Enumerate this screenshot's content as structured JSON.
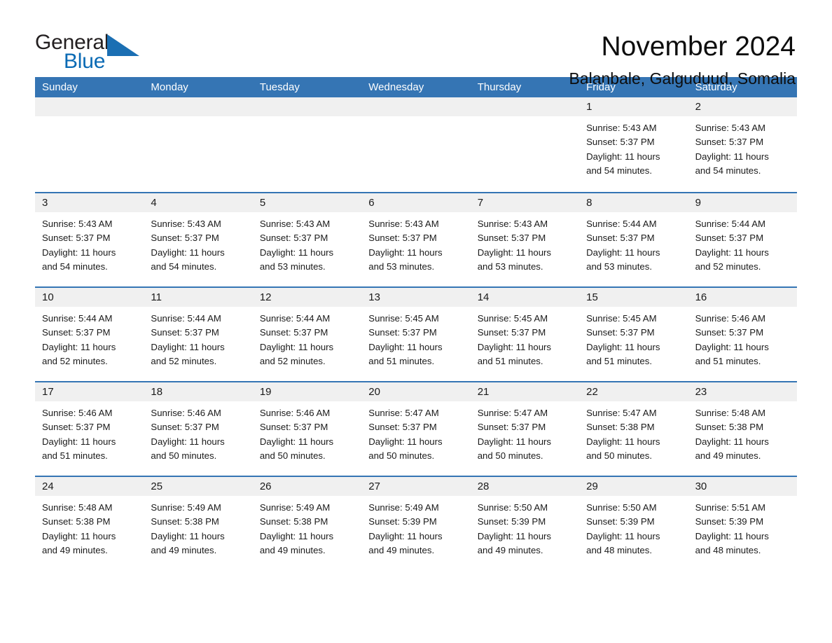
{
  "logo": {
    "text_primary": "General",
    "text_secondary": "Blue",
    "triangle_color": "#1b6fb3",
    "accent_color": "#0a6ab4"
  },
  "header": {
    "title": "November 2024",
    "subtitle": "Balanbale, Galguduud, Somalia"
  },
  "theme": {
    "header_blue": "#3575b4",
    "date_band_gray": "#f0f0f0",
    "text_dark": "#1a1a1a"
  },
  "calendar": {
    "weekdays": [
      "Sunday",
      "Monday",
      "Tuesday",
      "Wednesday",
      "Thursday",
      "Friday",
      "Saturday"
    ],
    "weeks": [
      [
        {
          "day": "",
          "lines": []
        },
        {
          "day": "",
          "lines": []
        },
        {
          "day": "",
          "lines": []
        },
        {
          "day": "",
          "lines": []
        },
        {
          "day": "",
          "lines": []
        },
        {
          "day": "1",
          "lines": [
            "Sunrise: 5:43 AM",
            "Sunset: 5:37 PM",
            "Daylight: 11 hours",
            "and 54 minutes."
          ]
        },
        {
          "day": "2",
          "lines": [
            "Sunrise: 5:43 AM",
            "Sunset: 5:37 PM",
            "Daylight: 11 hours",
            "and 54 minutes."
          ]
        }
      ],
      [
        {
          "day": "3",
          "lines": [
            "Sunrise: 5:43 AM",
            "Sunset: 5:37 PM",
            "Daylight: 11 hours",
            "and 54 minutes."
          ]
        },
        {
          "day": "4",
          "lines": [
            "Sunrise: 5:43 AM",
            "Sunset: 5:37 PM",
            "Daylight: 11 hours",
            "and 54 minutes."
          ]
        },
        {
          "day": "5",
          "lines": [
            "Sunrise: 5:43 AM",
            "Sunset: 5:37 PM",
            "Daylight: 11 hours",
            "and 53 minutes."
          ]
        },
        {
          "day": "6",
          "lines": [
            "Sunrise: 5:43 AM",
            "Sunset: 5:37 PM",
            "Daylight: 11 hours",
            "and 53 minutes."
          ]
        },
        {
          "day": "7",
          "lines": [
            "Sunrise: 5:43 AM",
            "Sunset: 5:37 PM",
            "Daylight: 11 hours",
            "and 53 minutes."
          ]
        },
        {
          "day": "8",
          "lines": [
            "Sunrise: 5:44 AM",
            "Sunset: 5:37 PM",
            "Daylight: 11 hours",
            "and 53 minutes."
          ]
        },
        {
          "day": "9",
          "lines": [
            "Sunrise: 5:44 AM",
            "Sunset: 5:37 PM",
            "Daylight: 11 hours",
            "and 52 minutes."
          ]
        }
      ],
      [
        {
          "day": "10",
          "lines": [
            "Sunrise: 5:44 AM",
            "Sunset: 5:37 PM",
            "Daylight: 11 hours",
            "and 52 minutes."
          ]
        },
        {
          "day": "11",
          "lines": [
            "Sunrise: 5:44 AM",
            "Sunset: 5:37 PM",
            "Daylight: 11 hours",
            "and 52 minutes."
          ]
        },
        {
          "day": "12",
          "lines": [
            "Sunrise: 5:44 AM",
            "Sunset: 5:37 PM",
            "Daylight: 11 hours",
            "and 52 minutes."
          ]
        },
        {
          "day": "13",
          "lines": [
            "Sunrise: 5:45 AM",
            "Sunset: 5:37 PM",
            "Daylight: 11 hours",
            "and 51 minutes."
          ]
        },
        {
          "day": "14",
          "lines": [
            "Sunrise: 5:45 AM",
            "Sunset: 5:37 PM",
            "Daylight: 11 hours",
            "and 51 minutes."
          ]
        },
        {
          "day": "15",
          "lines": [
            "Sunrise: 5:45 AM",
            "Sunset: 5:37 PM",
            "Daylight: 11 hours",
            "and 51 minutes."
          ]
        },
        {
          "day": "16",
          "lines": [
            "Sunrise: 5:46 AM",
            "Sunset: 5:37 PM",
            "Daylight: 11 hours",
            "and 51 minutes."
          ]
        }
      ],
      [
        {
          "day": "17",
          "lines": [
            "Sunrise: 5:46 AM",
            "Sunset: 5:37 PM",
            "Daylight: 11 hours",
            "and 51 minutes."
          ]
        },
        {
          "day": "18",
          "lines": [
            "Sunrise: 5:46 AM",
            "Sunset: 5:37 PM",
            "Daylight: 11 hours",
            "and 50 minutes."
          ]
        },
        {
          "day": "19",
          "lines": [
            "Sunrise: 5:46 AM",
            "Sunset: 5:37 PM",
            "Daylight: 11 hours",
            "and 50 minutes."
          ]
        },
        {
          "day": "20",
          "lines": [
            "Sunrise: 5:47 AM",
            "Sunset: 5:37 PM",
            "Daylight: 11 hours",
            "and 50 minutes."
          ]
        },
        {
          "day": "21",
          "lines": [
            "Sunrise: 5:47 AM",
            "Sunset: 5:37 PM",
            "Daylight: 11 hours",
            "and 50 minutes."
          ]
        },
        {
          "day": "22",
          "lines": [
            "Sunrise: 5:47 AM",
            "Sunset: 5:38 PM",
            "Daylight: 11 hours",
            "and 50 minutes."
          ]
        },
        {
          "day": "23",
          "lines": [
            "Sunrise: 5:48 AM",
            "Sunset: 5:38 PM",
            "Daylight: 11 hours",
            "and 49 minutes."
          ]
        }
      ],
      [
        {
          "day": "24",
          "lines": [
            "Sunrise: 5:48 AM",
            "Sunset: 5:38 PM",
            "Daylight: 11 hours",
            "and 49 minutes."
          ]
        },
        {
          "day": "25",
          "lines": [
            "Sunrise: 5:49 AM",
            "Sunset: 5:38 PM",
            "Daylight: 11 hours",
            "and 49 minutes."
          ]
        },
        {
          "day": "26",
          "lines": [
            "Sunrise: 5:49 AM",
            "Sunset: 5:38 PM",
            "Daylight: 11 hours",
            "and 49 minutes."
          ]
        },
        {
          "day": "27",
          "lines": [
            "Sunrise: 5:49 AM",
            "Sunset: 5:39 PM",
            "Daylight: 11 hours",
            "and 49 minutes."
          ]
        },
        {
          "day": "28",
          "lines": [
            "Sunrise: 5:50 AM",
            "Sunset: 5:39 PM",
            "Daylight: 11 hours",
            "and 49 minutes."
          ]
        },
        {
          "day": "29",
          "lines": [
            "Sunrise: 5:50 AM",
            "Sunset: 5:39 PM",
            "Daylight: 11 hours",
            "and 48 minutes."
          ]
        },
        {
          "day": "30",
          "lines": [
            "Sunrise: 5:51 AM",
            "Sunset: 5:39 PM",
            "Daylight: 11 hours",
            "and 48 minutes."
          ]
        }
      ]
    ]
  }
}
